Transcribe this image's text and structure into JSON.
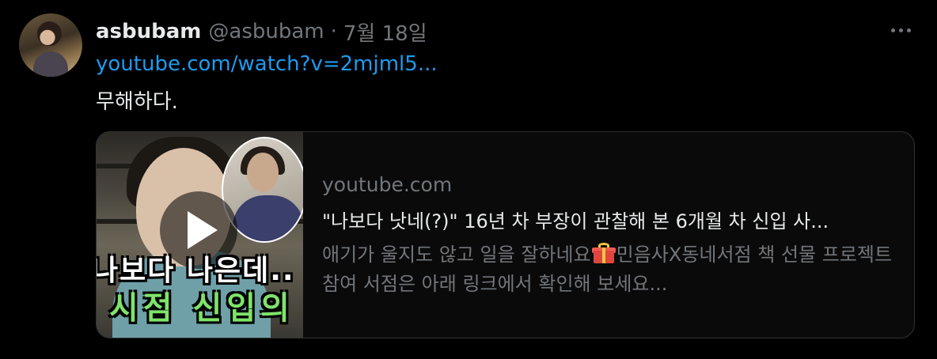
{
  "tweet": {
    "author_name": "asbubam",
    "author_handle": "@asbubam",
    "separator": "·",
    "date": "7월 18일",
    "link_text": "youtube.com/watch?v=2mjml5...",
    "text": "무해하다."
  },
  "card": {
    "domain": "youtube.com",
    "title": "\"나보다 낫네(?)\" 16년 차 부장이 관찰해 본 6개월 차 신입 사...",
    "description_part1": "애기가 울지도 않고 일을 잘하네요",
    "description_icon": "gift-emoji",
    "description_part2": "민음사X동네서점 책 선물 프로젝트 참여 서점은 아래 링크에서 확인해 보세요...",
    "thumbnail_caption_line1": "나보다 나은데..",
    "thumbnail_caption_line2": "시점 신입의"
  },
  "icons": {
    "more": "more-horizontal-icon",
    "play": "play-icon"
  },
  "colors": {
    "background": "#000000",
    "link": "#1d9bf0",
    "muted": "#71767b",
    "text": "#e7e9ea",
    "card_border": "#2f3336"
  }
}
